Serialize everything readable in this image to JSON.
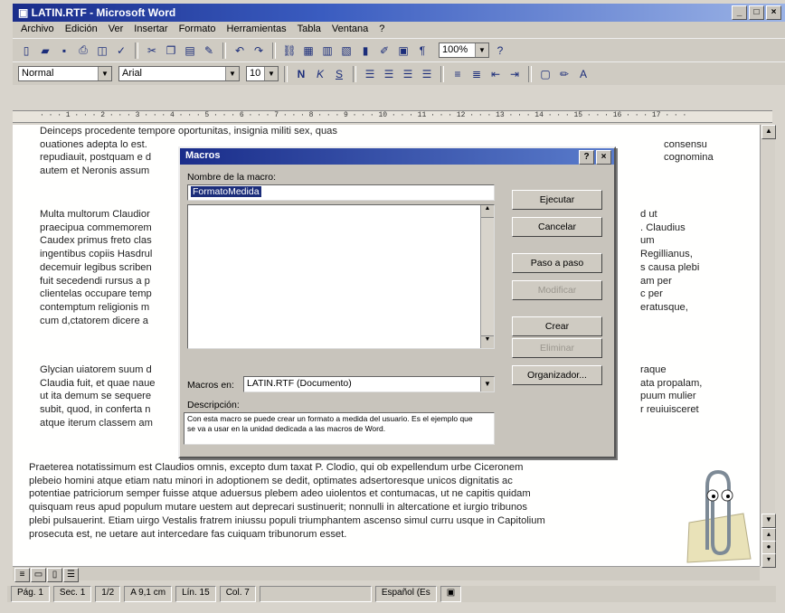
{
  "window": {
    "title": "LATIN.RTF - Microsoft Word",
    "controls": [
      "_",
      "□",
      "×"
    ]
  },
  "menu": [
    "Archivo",
    "Edición",
    "Ver",
    "Insertar",
    "Formato",
    "Herramientas",
    "Tabla",
    "Ventana",
    "?"
  ],
  "toolbar": {
    "zoom": "100%",
    "style": "Normal",
    "font": "Arial",
    "size": "10",
    "bold": "N",
    "italic": "K",
    "underline": "S"
  },
  "ruler": "· · · 1 · · · 2 · · · 3 · · · 4 · · · 5 · · · 6 · · · 7 · · · 8 · · · 9 · · · 10 · · · 11 · · · 12 · · · 13 · · · 14 · · · 15 · · · 16 · · · 17 · · ·",
  "document": {
    "p1": [
      "Deinceps procedente tempore",
      "oportunitas, insignia militi",
      "sex, quas",
      "ouationes adepta lo est.",
      "consensu",
      "repudiauit, postquam e d",
      "cognomina",
      "autem et Neronis assum"
    ],
    "p2": [
      "Multa multorum Claudior",
      "d ut",
      "praecipua commemorem",
      ". Claudius",
      "Caudex primus freto clas",
      "um",
      "ingentibus copiis Hasdrul",
      "Regillianus,",
      "decemuir legibus scriben",
      "s causa plebi",
      "fuit secedendi rursus a p",
      "am per",
      "clientelas occupare temp",
      "c per",
      "contemptum religionis m",
      "eratusque,",
      "cum d,ctatorem dicere a"
    ],
    "p3": [
      "Glycian uiatorem suum d",
      "raque",
      "Claudia fuit, et quae naue",
      "ata propalam,",
      "ut ita demum se sequere",
      "puum mulier",
      "subit, quod, in conferta n",
      "r reuiuisceret",
      "atque iterum classem am"
    ],
    "p4": [
      "Praeterea notatissimum est Claudios omnis, excepto dum taxat P. Clodio, qui ob expellendum urbe Ciceronem",
      "plebeio homini atque etiam natu minori in adoptionem se dedit, optimates adsertoresque unicos dignitatis ac",
      "potentiae patriciorum semper fuisse atque aduersus plebem adeo uiolentos et contumacas, ut ne capitis quidam",
      "quisquam reus apud populum mutare uestem aut deprecari sustinuerit; nonnulli in altercatione et iurgio tribunos",
      "plebi pulsauerint. Etiam uirgo Vestalis fratrem iniussu populi triumphantem ascenso simul curru usque in Capitolium",
      "prosecuta est, ne uetare aut intercedare fas cuiquam tribunorum esset."
    ]
  },
  "dialog": {
    "title": "Macros",
    "name_label": "Nombre de la macro:",
    "name_value": "FormatoMedida",
    "macros_in_label": "Macros en:",
    "macros_in_value": "LATIN.RTF (Documento)",
    "description_label": "Descripción:",
    "description_text": "Con esta macro se puede crear un formato a medida del usuario. Es el ejemplo que se va a usar en la unidad dedicada a las macros de Word.",
    "buttons": [
      "Ejecutar",
      "Cancelar",
      "Paso a paso",
      "Modificar",
      "Crear",
      "Eliminar",
      "Organizador..."
    ]
  },
  "status": {
    "page": "Pág. 1",
    "section": "Sec. 1",
    "pages": "1/2",
    "position": "A 9,1 cm",
    "line": "Lín. 15",
    "col": "Col. 7",
    "language": "Español (Es"
  }
}
